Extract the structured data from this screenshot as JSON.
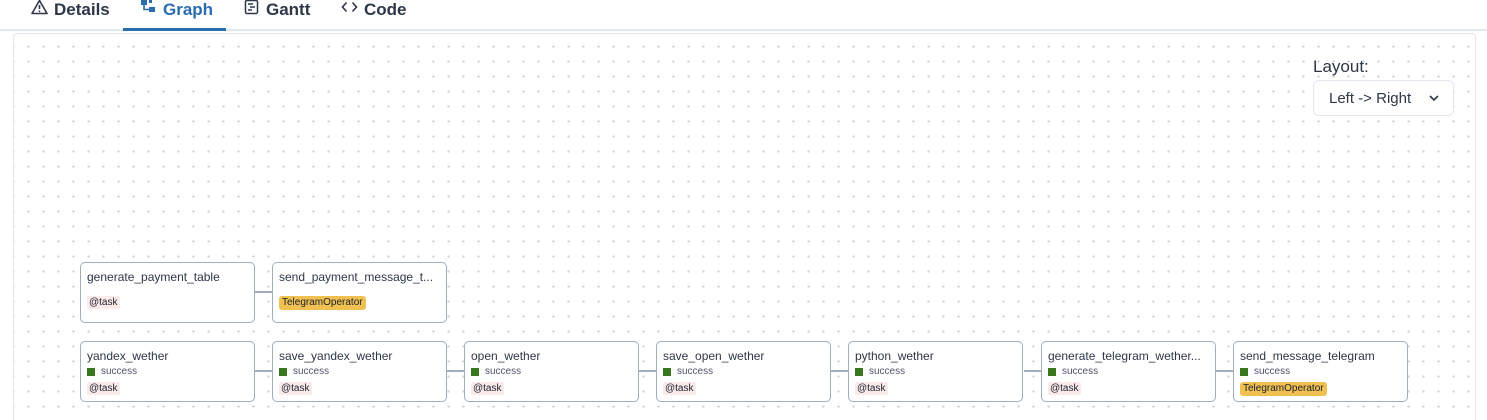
{
  "tabs": [
    {
      "label": "Details",
      "icon": "warning-icon"
    },
    {
      "label": "Graph",
      "icon": "graph-icon"
    },
    {
      "label": "Gantt",
      "icon": "gantt-icon"
    },
    {
      "label": "Code",
      "icon": "code-icon"
    }
  ],
  "active_tab": "Graph",
  "layout": {
    "label": "Layout:",
    "selected": "Left -> Right"
  },
  "nodes": [
    {
      "title": "generate_payment_table",
      "status": "",
      "tag": "@task"
    },
    {
      "title": "send_payment_message_t...",
      "status": "",
      "tag": "TelegramOperator"
    },
    {
      "title": "yandex_wether",
      "status": "success",
      "tag": "@task"
    },
    {
      "title": "save_yandex_wether",
      "status": "success",
      "tag": "@task"
    },
    {
      "title": "open_wether",
      "status": "success",
      "tag": "@task"
    },
    {
      "title": "save_open_wether",
      "status": "success",
      "tag": "@task"
    },
    {
      "title": "python_wether",
      "status": "success",
      "tag": "@task"
    },
    {
      "title": "generate_telegram_wether...",
      "status": "success",
      "tag": "@task"
    },
    {
      "title": "send_message_telegram",
      "status": "success",
      "tag": "TelegramOperator"
    }
  ],
  "colors": {
    "accent": "#2b6cb0",
    "success": "#38761d",
    "operator_tag": "#f0c050",
    "task_tag": "#fbeaea"
  }
}
